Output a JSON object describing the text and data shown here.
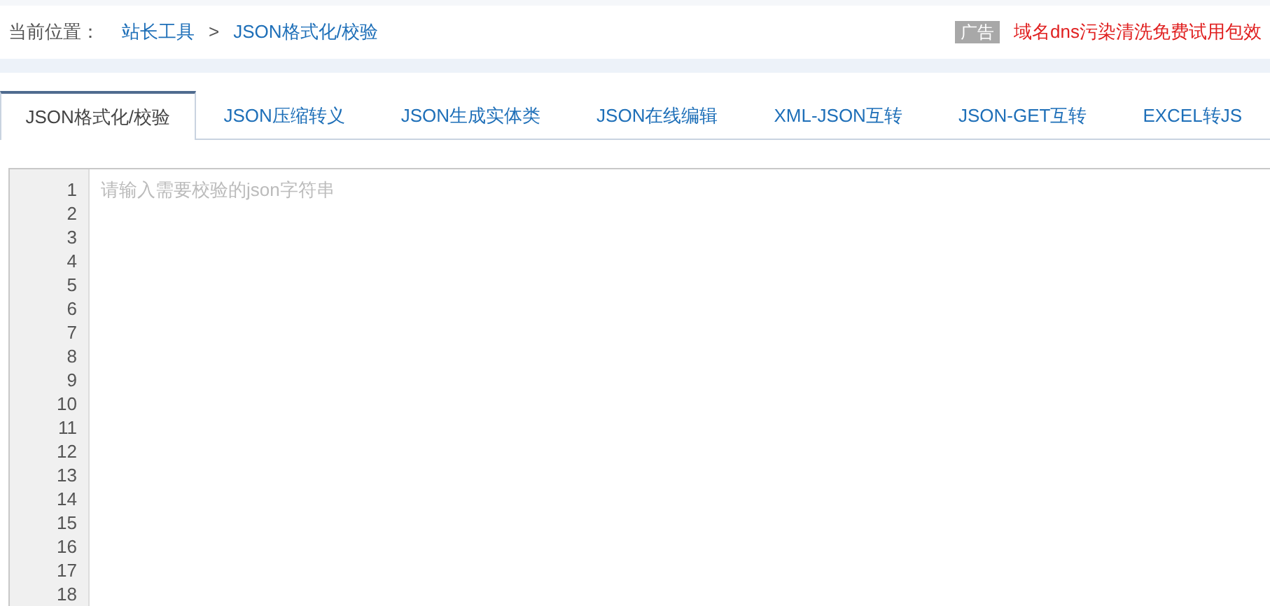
{
  "breadcrumb": {
    "label": "当前位置：",
    "items": [
      "站长工具",
      "JSON格式化/校验"
    ],
    "separator": ">"
  },
  "ad": {
    "badge": "广告",
    "text": "域名dns污染清洗免费试用包效"
  },
  "tabs": [
    {
      "label": "JSON格式化/校验",
      "selected": true
    },
    {
      "label": "JSON压缩转义",
      "selected": false
    },
    {
      "label": "JSON生成实体类",
      "selected": false
    },
    {
      "label": "JSON在线编辑",
      "selected": false
    },
    {
      "label": "XML-JSON互转",
      "selected": false
    },
    {
      "label": "JSON-GET互转",
      "selected": false
    },
    {
      "label": "EXCEL转JS",
      "selected": false
    }
  ],
  "editor": {
    "placeholder": "请输入需要校验的json字符串",
    "line_numbers": [
      "1",
      "2",
      "3",
      "4",
      "5",
      "6",
      "7",
      "8",
      "9",
      "10",
      "11",
      "12",
      "13",
      "14",
      "15",
      "16",
      "17",
      "18"
    ]
  }
}
